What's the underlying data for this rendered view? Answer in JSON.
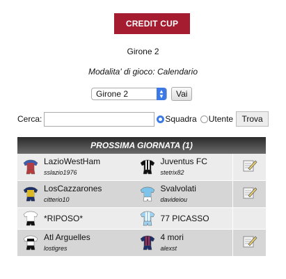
{
  "header": {
    "cup_button_label": "CREDIT CUP",
    "girone_title": "Girone 2",
    "mode_line": "Modalita' di gioco: Calendario"
  },
  "selector": {
    "selected": "Girone 2",
    "go_label": "Vai"
  },
  "search": {
    "label": "Cerca:",
    "value": "",
    "option_team": "Squadra",
    "option_user": "Utente",
    "selected_option": "Squadra",
    "submit_label": "Trova"
  },
  "table": {
    "heading": "PROSSIMA GIORNATA (1)",
    "matches": [
      {
        "home": "LazioWestHam",
        "home_coach": "sslazio1976",
        "away": "Juventus FC",
        "away_coach": "stetrix82",
        "home_kit": "red-blue-jersey-icon",
        "away_kit": "black-white-stripes-jersey-icon",
        "edit": true
      },
      {
        "home": "LosCazzarones",
        "home_coach": "citterio10",
        "away": "Svalvolati",
        "away_coach": "davideiou",
        "home_kit": "navy-yellow-jersey-icon",
        "away_kit": "light-blue-jersey-icon",
        "edit": true
      },
      {
        "home": "*RIPOSO*",
        "home_coach": "",
        "away": "77 PICASSO",
        "away_coach": "",
        "home_kit": "white-black-jersey-icon",
        "away_kit": "sky-stripes-jersey-icon",
        "edit": false
      },
      {
        "home": "Atl Arguelles",
        "home_coach": "lostigres",
        "away": "4 mori",
        "away_coach": "alexst",
        "home_kit": "black-white-jersey-icon",
        "away_kit": "navy-red-jersey-icon",
        "edit": true
      }
    ]
  },
  "colors": {
    "cup_button": "#a51c30",
    "accent": "#3b7ae6"
  }
}
